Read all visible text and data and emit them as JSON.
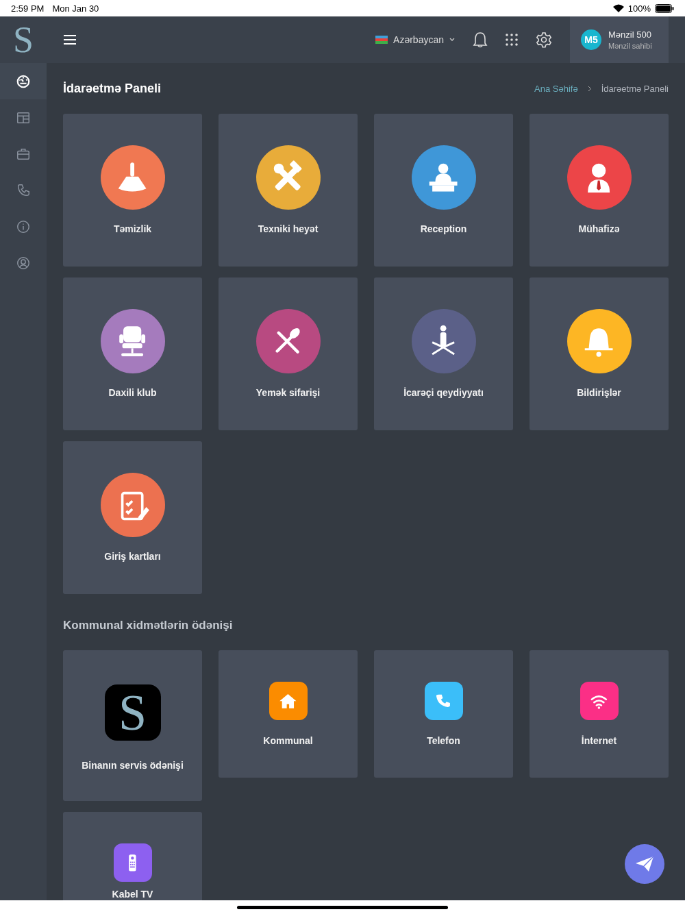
{
  "status_bar": {
    "time": "2:59 PM",
    "date": "Mon Jan 30",
    "battery": "100%"
  },
  "topbar": {
    "logo": "S",
    "language": "Azərbaycan",
    "user": {
      "initials": "M5",
      "name": "Mənzil 500",
      "role": "Mənzil sahibi"
    }
  },
  "sidebar": {
    "items": [
      {
        "kind": "dashboard",
        "selected": true
      },
      {
        "kind": "layout",
        "selected": false
      },
      {
        "kind": "briefcase",
        "selected": false
      },
      {
        "kind": "phone",
        "selected": false
      },
      {
        "kind": "info",
        "selected": false
      },
      {
        "kind": "user",
        "selected": false
      }
    ]
  },
  "page_title": "İdarəetmə Paneli",
  "breadcrumbs": [
    {
      "label": "Ana Səhifə",
      "selected": false
    },
    {
      "label": "İdarəetmə Paneli",
      "selected": true
    }
  ],
  "services": [
    {
      "label": "Təmizlik",
      "kind": "broom",
      "color": "#f07852"
    },
    {
      "label": "Texniki heyət",
      "kind": "tools",
      "color": "#e8ac3a"
    },
    {
      "label": "Reception",
      "kind": "reception",
      "color": "#3f97d8"
    },
    {
      "label": "Mühafizə",
      "kind": "guard",
      "color": "#ec4548"
    },
    {
      "label": "Daxili klub",
      "kind": "chair",
      "color": "#a57bbd"
    },
    {
      "label": "Yemək sifarişi",
      "kind": "cutlery",
      "color": "#b84a81"
    },
    {
      "label": "İcarəçi qeydiyyatı",
      "kind": "tenant",
      "color": "#5b6088"
    },
    {
      "label": "Bildirişlər",
      "kind": "bell",
      "color": "#fdb624"
    },
    {
      "label": "Giriş kartları",
      "kind": "clipboard",
      "color": "#ec7150"
    }
  ],
  "payments": {
    "title": "Kommunal xidmətlərin ödənişi",
    "items": [
      {
        "label": "Binanın servis ödənişi",
        "kind": "logo",
        "logo": "S",
        "color": "#000000"
      },
      {
        "label": "Kommunal",
        "kind": "house",
        "color": "#fb8c00"
      },
      {
        "label": "Telefon",
        "kind": "phone",
        "color": "#3bbef9"
      },
      {
        "label": "İnternet",
        "kind": "wifi",
        "color": "#fb2f86"
      },
      {
        "label": "Kabel TV",
        "kind": "remote",
        "color": "#8d60f0"
      }
    ]
  }
}
